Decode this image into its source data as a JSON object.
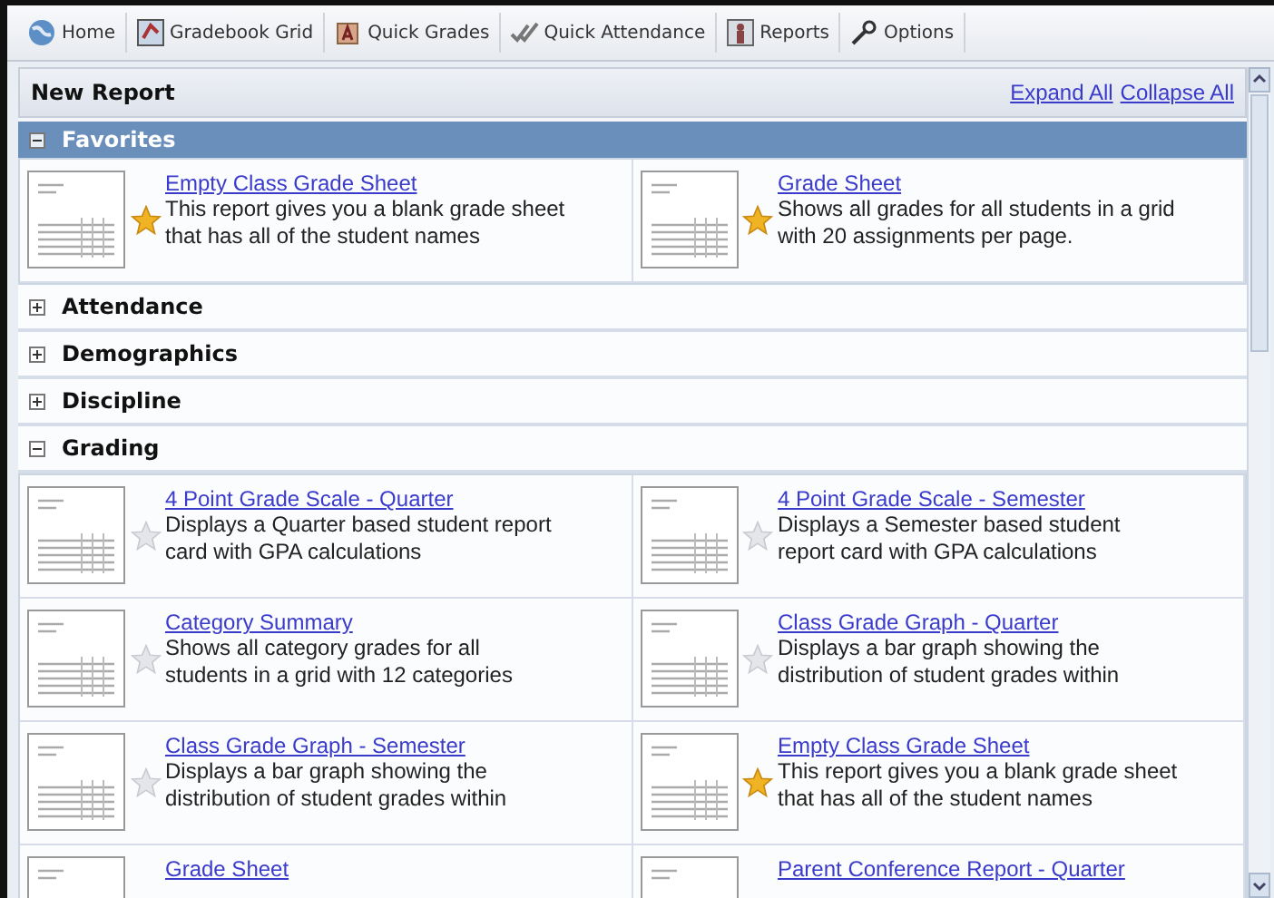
{
  "toolbar": [
    "Home",
    "Gradebook Grid",
    "Quick Grades",
    "Quick Attendance",
    "Reports",
    "Options"
  ],
  "header": {
    "title": "New Report",
    "links": [
      "Expand All",
      "Collapse All"
    ]
  },
  "sections": [
    {
      "title": "Favorites",
      "expanded": true,
      "selected": true,
      "reports": [
        {
          "title": "Empty Class Grade Sheet",
          "starred": true,
          "description": "This report gives you a blank grade sheet that has all of the student names"
        },
        {
          "title": "Grade Sheet",
          "starred": true,
          "description": "Shows all grades for all students in a grid with 20 assignments per page."
        }
      ]
    },
    {
      "title": "Attendance",
      "expanded": false,
      "selected": false
    },
    {
      "title": "Demographics",
      "expanded": false,
      "selected": false
    },
    {
      "title": "Discipline",
      "expanded": false,
      "selected": false
    },
    {
      "title": "Grading",
      "expanded": true,
      "selected": false,
      "reports": [
        {
          "title": "4 Point Grade Scale - Quarter",
          "starred": false,
          "description": "Displays a Quarter based student report card with GPA calculations"
        },
        {
          "title": "4 Point Grade Scale - Semester",
          "starred": false,
          "description": "Displays a Semester based student report card with GPA calculations"
        },
        {
          "title": "Category Summary",
          "starred": false,
          "description": "Shows all category grades for all students in a grid with 12 categories"
        },
        {
          "title": "Class Grade Graph - Quarter",
          "starred": false,
          "description": "Displays a bar graph showing the distribution of student grades within"
        },
        {
          "title": "Class Grade Graph - Semester",
          "starred": false,
          "description": "Displays a bar graph showing the distribution of student grades within"
        },
        {
          "title": "Empty Class Grade Sheet",
          "starred": true,
          "description": "This report gives you a blank grade sheet that has all of the student names"
        },
        {
          "title": "Grade Sheet"
        },
        {
          "title": "Parent Conference Report - Quarter"
        }
      ]
    }
  ]
}
